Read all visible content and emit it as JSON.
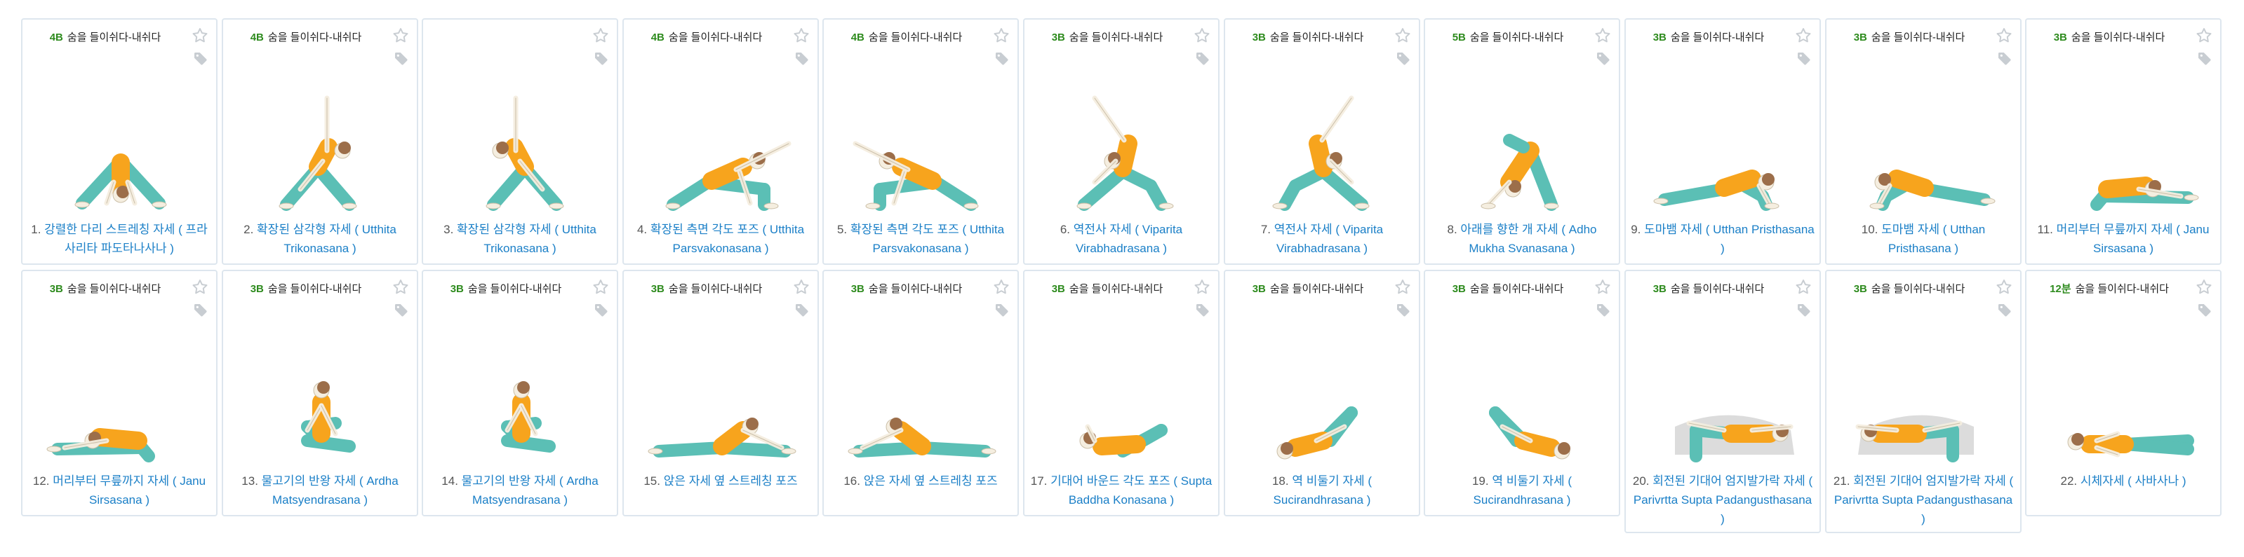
{
  "colors": {
    "breath_green": "#2e8b1e",
    "link_blue": "#1a7fc7",
    "body_teal": "#5bbfb5",
    "shirt_orange": "#f7a41d",
    "skin": "#f5eee0",
    "hair": "#9c6e4a",
    "card_border": "#dde6ee",
    "icon_grey": "#c8cdd2"
  },
  "icons": {
    "favorite": "star-icon",
    "tag": "tag-icon"
  },
  "cards": [
    {
      "num": "1.",
      "breath": "4B",
      "breath_text": "숨을 들이쉬다-내쉬다",
      "title": "강렬한 다리 스트레칭 자세 ( 프라사리타 파도타나사나 )"
    },
    {
      "num": "2.",
      "breath": "4B",
      "breath_text": "숨을 들이쉬다-내쉬다",
      "title": "확장된 삼각형 자세 ( Utthita Trikonasana )"
    },
    {
      "num": "3.",
      "breath": "",
      "breath_text": "",
      "title": "확장된 삼각형 자세 ( Utthita Trikonasana )"
    },
    {
      "num": "4.",
      "breath": "4B",
      "breath_text": "숨을 들이쉬다-내쉬다",
      "title": "확장된 측면 각도 포즈 ( Utthita Parsvakonasana )"
    },
    {
      "num": "5.",
      "breath": "4B",
      "breath_text": "숨을 들이쉬다-내쉬다",
      "title": "확장된 측면 각도 포즈 ( Utthita Parsvakonasana )"
    },
    {
      "num": "6.",
      "breath": "3B",
      "breath_text": "숨을 들이쉬다-내쉬다",
      "title": "역전사 자세 ( Viparita Virabhadrasana )"
    },
    {
      "num": "7.",
      "breath": "3B",
      "breath_text": "숨을 들이쉬다-내쉬다",
      "title": "역전사 자세 ( Viparita Virabhadrasana )"
    },
    {
      "num": "8.",
      "breath": "5B",
      "breath_text": "숨을 들이쉬다-내쉬다",
      "title": "아래를 향한 개 자세 ( Adho Mukha Svanasana )"
    },
    {
      "num": "9.",
      "breath": "3B",
      "breath_text": "숨을 들이쉬다-내쉬다",
      "title": "도마뱀 자세 ( Utthan Pristhasana )"
    },
    {
      "num": "10.",
      "breath": "3B",
      "breath_text": "숨을 들이쉬다-내쉬다",
      "title": "도마뱀 자세 ( Utthan Pristhasana )"
    },
    {
      "num": "11.",
      "breath": "3B",
      "breath_text": "숨을 들이쉬다-내쉬다",
      "title": "머리부터 무릎까지 자세 ( Janu Sirsasana )"
    },
    {
      "num": "12.",
      "breath": "3B",
      "breath_text": "숨을 들이쉬다-내쉬다",
      "title": "머리부터 무릎까지 자세 ( Janu Sirsasana )"
    },
    {
      "num": "13.",
      "breath": "3B",
      "breath_text": "숨을 들이쉬다-내쉬다",
      "title": "물고기의 반왕 자세 ( Ardha Matsyendrasana )"
    },
    {
      "num": "14.",
      "breath": "3B",
      "breath_text": "숨을 들이쉬다-내쉬다",
      "title": "물고기의 반왕 자세 ( Ardha Matsyendrasana )"
    },
    {
      "num": "15.",
      "breath": "3B",
      "breath_text": "숨을 들이쉬다-내쉬다",
      "title": "앉은 자세 옆 스트레칭 포즈"
    },
    {
      "num": "16.",
      "breath": "3B",
      "breath_text": "숨을 들이쉬다-내쉬다",
      "title": "앉은 자세 옆 스트레칭 포즈"
    },
    {
      "num": "17.",
      "breath": "3B",
      "breath_text": "숨을 들이쉬다-내쉬다",
      "title": "기대어 바운드 각도 포즈 ( Supta Baddha Konasana )"
    },
    {
      "num": "18.",
      "breath": "3B",
      "breath_text": "숨을 들이쉬다-내쉬다",
      "title": "역 비둘기 자세 ( Sucirandhrasana )"
    },
    {
      "num": "19.",
      "breath": "3B",
      "breath_text": "숨을 들이쉬다-내쉬다",
      "title": "역 비둘기 자세 ( Sucirandhrasana )"
    },
    {
      "num": "20.",
      "breath": "3B",
      "breath_text": "숨을 들이쉬다-내쉬다",
      "title": "회전된 기대어 엄지발가락 자세 ( Parivrtta Supta Padangusthasana )"
    },
    {
      "num": "21.",
      "breath": "3B",
      "breath_text": "숨을 들이쉬다-내쉬다",
      "title": "회전된 기대어 엄지발가락 자세 ( Parivrtta Supta Padangusthasana )"
    },
    {
      "num": "22.",
      "breath": "12분",
      "breath_text": "숨을 들이쉬다-내쉬다",
      "title": "시체자세 ( 사바사나 )"
    }
  ]
}
